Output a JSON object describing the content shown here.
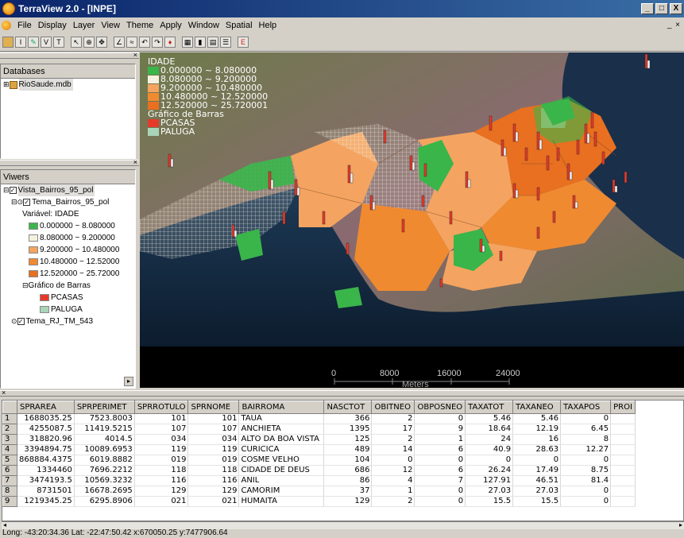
{
  "window": {
    "title": "TerraView 2.0 - [INPE]",
    "buttons": [
      "_",
      "□",
      "X"
    ]
  },
  "menu": [
    "File",
    "Display",
    "Layer",
    "View",
    "Theme",
    "Apply",
    "Window",
    "Spatial",
    "Help"
  ],
  "mdi_buttons": "_ ×",
  "toolbar_icons": [
    "db-icon",
    "info-icon",
    "pencil-icon",
    "view-icon",
    "theme-icon",
    "pointer-icon",
    "zoom-icon",
    "pan-icon",
    "line-icon",
    "edit-icon",
    "undo-icon",
    "redo-icon",
    "fill-icon",
    "table-icon",
    "graph-icon",
    "print-icon",
    "layers-icon",
    "exec-icon"
  ],
  "databases": {
    "header": "Databases",
    "root": "RioSaude.mdb"
  },
  "viewers": {
    "header": "Viwers",
    "view": "Vista_Bairros_95_pol",
    "theme": "Tema_Bairros_95_pol",
    "variable_label": "Variável: IDADE",
    "classes": [
      {
        "label": "0.000000 ~ 8.080000",
        "color": "#3ab54a"
      },
      {
        "label": "8.080000 ~ 9.200000",
        "color": "#f5f1e0"
      },
      {
        "label": "9.200000 ~ 10.480000",
        "color": "#f4a460"
      },
      {
        "label": "10.480000 ~ 12.52000",
        "color": "#f08a30"
      },
      {
        "label": "12.520000 ~ 25.72000",
        "color": "#e87020"
      }
    ],
    "chart_label": "Gráfico de Barras",
    "chart_items": [
      {
        "label": "PCASAS",
        "color": "#e53a2a"
      },
      {
        "label": "PALUGA",
        "color": "#a9d4b8"
      }
    ],
    "theme2": "Tema_RJ_TM_543"
  },
  "map_legend": {
    "title": "IDADE",
    "classes": [
      {
        "label": "0.000000 ~ 8.080000",
        "color": "#3ab54a"
      },
      {
        "label": "8.080000 ~ 9.200000",
        "color": "#f5f1e0"
      },
      {
        "label": "9.200000 ~ 10.480000",
        "color": "#f4a460"
      },
      {
        "label": "10.480000 ~ 12.520000",
        "color": "#f08a30"
      },
      {
        "label": "12.520000 ~ 25.720001",
        "color": "#e87020"
      }
    ],
    "chart_title": "Gráfico de Barras",
    "chart_items": [
      {
        "label": "PCASAS",
        "color": "#e53a2a"
      },
      {
        "label": "PALUGA",
        "color": "#a9d4b8"
      }
    ]
  },
  "scale": {
    "ticks": [
      "0",
      "8000",
      "16000",
      "24000"
    ],
    "unit": "Meters"
  },
  "table": {
    "columns": [
      "",
      "SPRAREA",
      "SPRPERIMET",
      "SPRROTULO",
      "SPRNOME",
      "BAIRROMA",
      "NASCTOT",
      "OBITNEO",
      "OBPOSNEO",
      "TAXATOT",
      "TAXANEO",
      "TAXAPOS",
      "PROI"
    ],
    "rows": [
      [
        "1",
        "1688035.25",
        "7523.8003",
        "101",
        "101",
        "TAUA",
        "366",
        "2",
        "0",
        "5.46",
        "5.46",
        "0",
        ""
      ],
      [
        "2",
        "4255087.5",
        "11419.5215",
        "107",
        "107",
        "ANCHIETA",
        "1395",
        "17",
        "9",
        "18.64",
        "12.19",
        "6.45",
        ""
      ],
      [
        "3",
        "318820.96",
        "4014.5",
        "034",
        "034",
        "ALTO DA BOA VISTA",
        "125",
        "2",
        "1",
        "24",
        "16",
        "8",
        ""
      ],
      [
        "4",
        "3394894.75",
        "10089.6953",
        "119",
        "119",
        "CURICICA",
        "489",
        "14",
        "6",
        "40.9",
        "28.63",
        "12.27",
        ""
      ],
      [
        "5",
        "868884.4375",
        "6019.8882",
        "019",
        "019",
        "COSME VELHO",
        "104",
        "0",
        "0",
        "0",
        "0",
        "0",
        ""
      ],
      [
        "6",
        "1334460",
        "7696.2212",
        "118",
        "118",
        "CIDADE DE DEUS",
        "686",
        "12",
        "6",
        "26.24",
        "17.49",
        "8.75",
        ""
      ],
      [
        "7",
        "3474193.5",
        "10569.3232",
        "116",
        "116",
        "ANIL",
        "86",
        "4",
        "7",
        "127.91",
        "46.51",
        "81.4",
        ""
      ],
      [
        "8",
        "8731501",
        "16678.2695",
        "129",
        "129",
        "CAMORIM",
        "37",
        "1",
        "0",
        "27.03",
        "27.03",
        "0",
        ""
      ],
      [
        "9",
        "1219345.25",
        "6295.8906",
        "021",
        "021",
        "HUMAITA",
        "129",
        "2",
        "0",
        "15.5",
        "15.5",
        "0",
        ""
      ]
    ]
  },
  "status": "Long: -43:20:34.36 Lat: -22:47:50.42 x:670050.25 y:7477906.64",
  "colors": {
    "class1": "#3ab54a",
    "class2": "#f5f1e0",
    "class3": "#f4a460",
    "class4": "#f08a30",
    "class5": "#e87020",
    "bar_pcasas": "#e53a2a",
    "bar_paluga": "#f2f2f2"
  }
}
